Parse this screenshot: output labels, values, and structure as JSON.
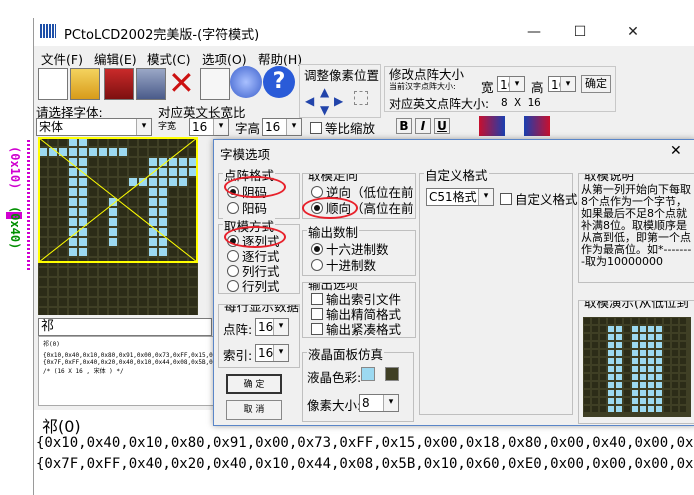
{
  "window": {
    "title": "PCtoLCD2002完美版-(字符模式)",
    "minimize": "—",
    "maximize": "☐",
    "close": "✕"
  },
  "menu": [
    "文件(F)",
    "编辑(E)",
    "模式(C)",
    "选项(O)",
    "帮助(H)"
  ],
  "toolbar": {
    "adjust_label": "调整像素位置",
    "modify_label": "修改点阵大小",
    "current_label": "当前汉字点阵大小:",
    "width_label": "宽",
    "width_value": "16",
    "height_label": "高",
    "height_value": "16",
    "confirm": "确定",
    "eng_size_label": "对应英文点阵大小:",
    "eng_size_value": "8 X 16"
  },
  "font_row": {
    "select_font_label": "请选择字体:",
    "font_value": "宋体",
    "ratio_label": "对应英文长宽比",
    "char_width_label": "字宽",
    "char_width_value": "16",
    "char_height_label": "字高",
    "char_height_value": "16",
    "equal_scale_label": "等比缩放",
    "bold": "B",
    "italic": "I",
    "underline": "U"
  },
  "side_labels": {
    "left": "(0x10)",
    "right": "(0x40)"
  },
  "preview_char": "祁",
  "output_small": {
    "title": "祁(0)",
    "line1": "{0x10,0x40,0x10,0x80,0x91,0x00,0x73,0xFF,0x15,0x00,0x18,0x80,0x00,0x40,0x00,0x00},",
    "line2": "{0x7F,0xFF,0x40,0x20,0x40,0x10,0x44,0x08,0x5B,0x10,0x60,0xE0,0x00,0x00,0x00,0x00},",
    "line3": "/* (16 X 16 , 宋体 ) */"
  },
  "output_large": {
    "title": "祁(0)",
    "line1": "{0x10,0x40,0x10,0x80,0x91,0x00,0x73,0xFF,0x15,0x00,0x18,0x80,0x00,0x40,0x00,0x00},",
    "line2": "{0x7F,0xFF,0x40,0x20,0x40,0x10,0x44,0x08,0x5B,0x10,0x60,0xE0,0x00,0x00,0x00,0x00},"
  },
  "dialog": {
    "title": "字模选项",
    "close": "✕",
    "dot_format": {
      "label": "点阵格式",
      "options": [
        "阴码",
        "阳码"
      ],
      "selected": 0
    },
    "mode_direction": {
      "label": "取模走向",
      "options": [
        "逆向（低位在前",
        "顺向（高位在前"
      ],
      "selected": 1
    },
    "custom_format": {
      "label": "自定义格式",
      "select_value": "C51格式",
      "checkbox_label": "自定义格式"
    },
    "mode_method": {
      "label": "取模方式",
      "options": [
        "逐列式",
        "逐行式",
        "列行式",
        "行列式"
      ],
      "selected": 0
    },
    "output_number": {
      "label": "输出数制",
      "options": [
        "十六进制数",
        "十进制数"
      ],
      "selected": 0
    },
    "per_line": {
      "label": "每行显示数据",
      "dot_label": "点阵:",
      "dot_value": "16",
      "index_label": "索引:",
      "index_value": "16"
    },
    "output_options": {
      "label": "输出选项",
      "options": [
        "输出索引文件",
        "输出精简格式",
        "输出紧凑格式"
      ]
    },
    "lcd_sim": {
      "label": "液晶面板仿真",
      "color_label": "液晶色彩:",
      "pixel_label": "像素大小:",
      "pixel_value": "8"
    },
    "buttons": {
      "ok": "确 定",
      "cancel": "取 消"
    },
    "explain": {
      "label": "取模说明",
      "text": "从第一列开始向下每取8个点作为一个字节，如果最后不足8个点就补满8位。取模顺序是从高到低，即第一个点作为最高位。如*--------取为10000000"
    },
    "demo_label": "取模演示(从低位到"
  },
  "colors": {
    "grid_dark": "#3f3f25",
    "grid_lit": "#9cd9f1",
    "lcd_color_1": "#9cd9f1",
    "lcd_color_2": "#3f3f25",
    "highlight": "#e8212b",
    "yellow_line": "#ffff00",
    "magenta": "#d000d0",
    "green": "#009000"
  }
}
